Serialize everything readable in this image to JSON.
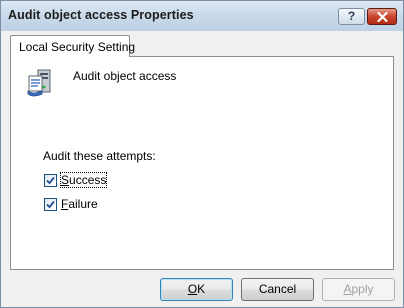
{
  "window": {
    "title": "Audit object access Properties",
    "help_label": "?",
    "close_icon": "close-icon"
  },
  "tab": {
    "label": "Local Security Setting"
  },
  "policy": {
    "icon": "audit-policy-icon",
    "name": "Audit object access"
  },
  "audit": {
    "group_label": "Audit these attempts:",
    "success": {
      "mnemonic": "S",
      "rest": "uccess",
      "checked": true
    },
    "failure": {
      "mnemonic": "F",
      "rest": "ailure",
      "checked": true
    }
  },
  "buttons": {
    "ok": {
      "mnemonic": "O",
      "rest": "K",
      "enabled": true
    },
    "cancel": {
      "label": "Cancel",
      "enabled": true
    },
    "apply": {
      "mnemonic": "A",
      "rest": "pply",
      "enabled": false
    }
  },
  "colors": {
    "title_bar": "#c9d9ea",
    "close_button": "#c8452e",
    "checkbox_border": "#1c5180"
  }
}
